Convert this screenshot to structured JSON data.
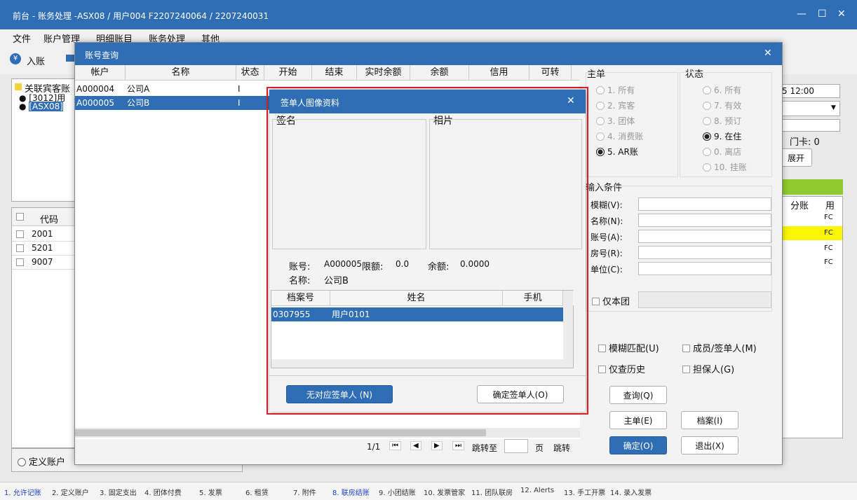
{
  "app": {
    "title": "前台 - 账务处理 -ASX08 / 用户004 F2207240064 / 2207240031"
  },
  "menu": [
    "文件",
    "账户管理",
    "明细账目",
    "账务处理",
    "其他"
  ],
  "toolbar": {
    "entry": "入账"
  },
  "bg": {
    "tree_root": "关联宾客账",
    "tree_child1": "[3012]用",
    "tree_child2": "[ASX08]",
    "grid_headers": [
      "代码"
    ],
    "grid_rows": [
      "2001",
      "5201",
      "9007"
    ],
    "time": "5 12:00",
    "door": "门卡: 0",
    "expand": "展开",
    "col_split": "分账",
    "col_user": "用",
    "fc": [
      "FC",
      "FC",
      "FC",
      "FC"
    ],
    "define_account": "定义账户"
  },
  "query": {
    "title": "账号查询",
    "columns": [
      "帐户",
      "名称",
      "状态",
      "开始",
      "结束",
      "实时余额",
      "余额",
      "信用",
      "可转"
    ],
    "rows": [
      {
        "account": "A000004",
        "name": "公司A",
        "status": "I"
      },
      {
        "account": "A000005",
        "name": "公司B",
        "status": "I"
      }
    ],
    "main_label": "主单",
    "status_label": "状态",
    "main_options": [
      "1. 所有",
      "2. 宾客",
      "3. 团体",
      "4. 消费账",
      "5. AR账"
    ],
    "status_options": [
      "6. 所有",
      "7. 有效",
      "8. 预订",
      "9. 在住",
      "0. 离店",
      "10. 挂账"
    ],
    "input_label": "输入条件",
    "inputs": [
      "模糊(V):",
      "名称(N):",
      "账号(A):",
      "房号(R):",
      "单位(C):"
    ],
    "only_group": "仅本团",
    "fuzzy": "模糊匹配(U)",
    "member": "成员/签单人(M)",
    "history": "仅查历史",
    "guarantor": "担保人(G)",
    "btn_query": "查询(Q)",
    "btn_main": "主单(E)",
    "btn_archive": "档案(I)",
    "btn_ok": "确定(O)",
    "btn_exit": "退出(X)",
    "pager": "1/1",
    "goto": "跳转至",
    "page": "页",
    "jump": "跳转"
  },
  "signer": {
    "title": "签单人图像资料",
    "sign": "签名",
    "photo": "相片",
    "account_label": "账号:",
    "account": "A000005",
    "limit_label": "限额:",
    "limit": "0.0",
    "balance_label": "余额:",
    "balance": "0.0000",
    "name_label": "名称:",
    "name": "公司B",
    "columns": [
      "档案号",
      "姓名",
      "手机"
    ],
    "rows": [
      {
        "file": "0307955",
        "name": "用户0101",
        "phone": ""
      }
    ],
    "btn_none": "无对应签单人 (N)",
    "btn_confirm": "确定签单人(O)"
  },
  "tabs": [
    "1. 允许记账",
    "2. 定义账户",
    "3. 固定支出",
    "4. 团体付费",
    "5. 发票",
    "6. 租赁",
    "7. 附件",
    "8. 联房结账",
    "9. 小团结账",
    "10. 发票管家",
    "11. 团队联房",
    "12. Alerts",
    "13. 手工开票",
    "14. 录入发票"
  ]
}
